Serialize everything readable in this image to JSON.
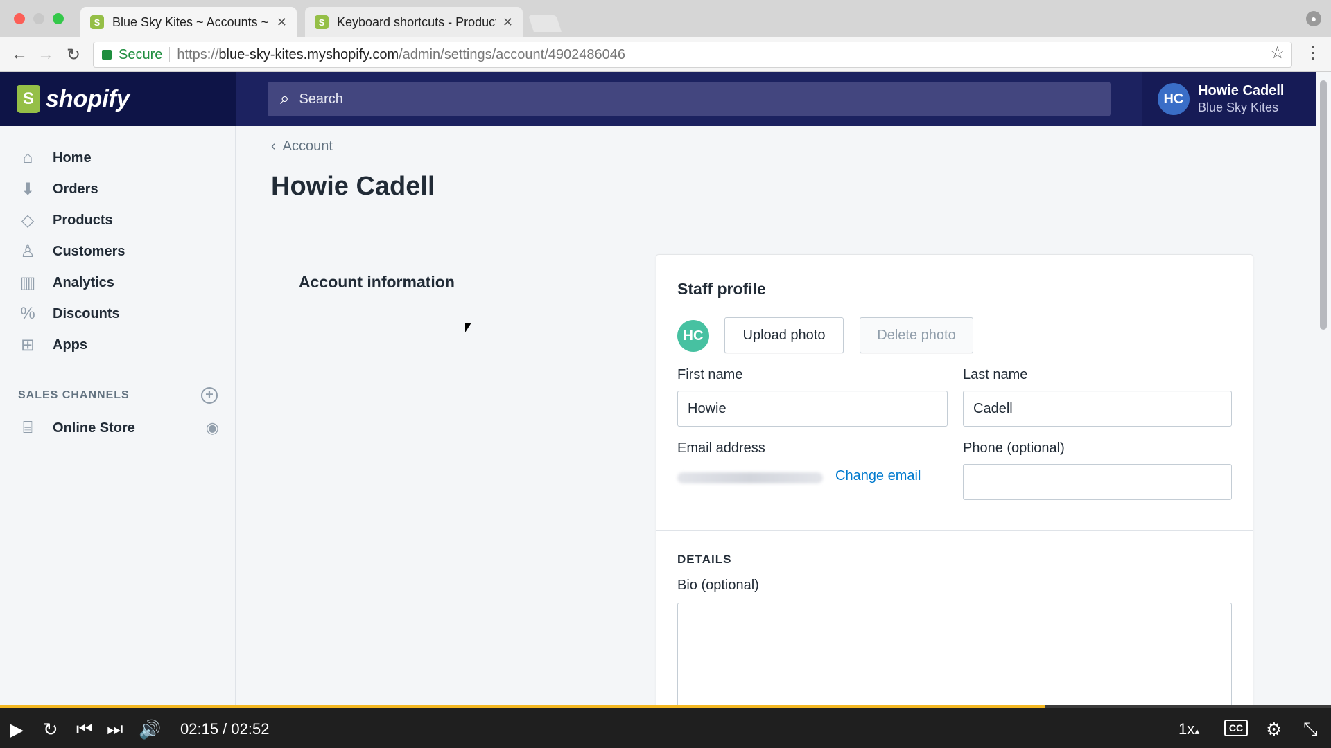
{
  "browser": {
    "tabs": [
      {
        "title": "Blue Sky Kites ~ Accounts ~ Sh",
        "active": true
      },
      {
        "title": "Keyboard shortcuts - Producti",
        "active": false
      }
    ],
    "secure_label": "Secure",
    "url_scheme": "https://",
    "url_host": "blue-sky-kites.myshopify.com",
    "url_path": "/admin/settings/account/4902486046"
  },
  "topbar": {
    "brand": "shopify",
    "search_placeholder": "Search",
    "user_initials": "HC",
    "user_name": "Howie Cadell",
    "store_name": "Blue Sky Kites"
  },
  "sidebar": {
    "items": [
      {
        "label": "Home",
        "icon": "home-icon"
      },
      {
        "label": "Orders",
        "icon": "orders-icon"
      },
      {
        "label": "Products",
        "icon": "tag-icon"
      },
      {
        "label": "Customers",
        "icon": "person-icon"
      },
      {
        "label": "Analytics",
        "icon": "bar-chart-icon"
      },
      {
        "label": "Discounts",
        "icon": "discount-icon"
      },
      {
        "label": "Apps",
        "icon": "apps-icon"
      }
    ],
    "sales_channels_heading": "SALES CHANNELS",
    "channels": [
      {
        "label": "Online Store",
        "icon": "store-icon"
      }
    ]
  },
  "main": {
    "breadcrumb": "Account",
    "page_title": "Howie Cadell",
    "section_title": "Account information",
    "card": {
      "title": "Staff profile",
      "avatar_initials": "HC",
      "upload_label": "Upload photo",
      "delete_label": "Delete photo",
      "first_name_label": "First name",
      "first_name_value": "Howie",
      "last_name_label": "Last name",
      "last_name_value": "Cadell",
      "email_label": "Email address",
      "change_email_label": "Change email",
      "phone_label": "Phone (optional)",
      "phone_value": "",
      "details_heading": "DETAILS",
      "bio_label": "Bio (optional)"
    }
  },
  "player": {
    "time": "02:15 / 02:52",
    "progress_fraction": 0.785,
    "speed": "1x",
    "cc_label": "CC"
  },
  "colors": {
    "topbar_bg": "#1c2260",
    "logo_green": "#95bf47",
    "link_blue": "#007ace",
    "avatar_green": "#47c1a1",
    "progress_yellow": "#f4b822"
  }
}
